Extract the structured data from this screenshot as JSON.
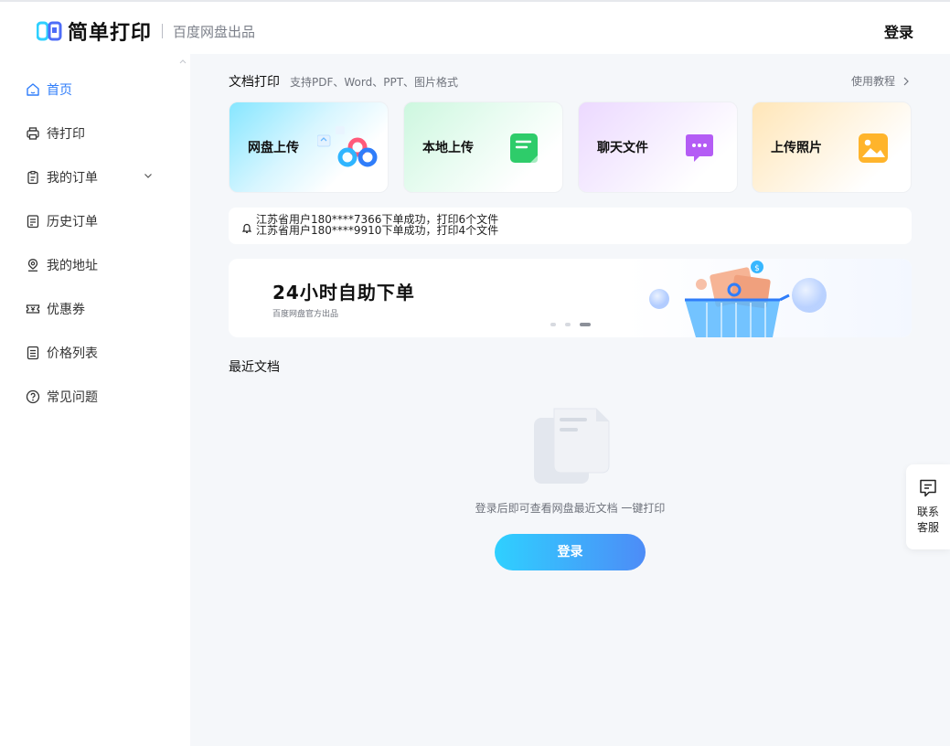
{
  "header": {
    "brand": "简单打印",
    "sub_brand": "百度网盘出品",
    "login_label": "登录"
  },
  "sidebar": {
    "items": [
      {
        "label": "首页",
        "icon": "home-icon",
        "active": true
      },
      {
        "label": "待打印",
        "icon": "printer-icon",
        "active": false
      },
      {
        "label": "我的订单",
        "icon": "clipboard-icon",
        "active": false,
        "expandable": true
      },
      {
        "label": "历史订单",
        "icon": "history-order-icon",
        "active": false
      },
      {
        "label": "我的地址",
        "icon": "location-icon",
        "active": false
      },
      {
        "label": "优惠券",
        "icon": "coupon-icon",
        "active": false
      },
      {
        "label": "价格列表",
        "icon": "price-list-icon",
        "active": false
      },
      {
        "label": "常见问题",
        "icon": "question-icon",
        "active": false
      }
    ]
  },
  "doc_print": {
    "title": "文档打印",
    "subtitle": "支持PDF、Word、PPT、图片格式",
    "tutorial_label": "使用教程",
    "cards": [
      {
        "label": "网盘上传",
        "icon": "netdisk-cloud-icon"
      },
      {
        "label": "本地上传",
        "icon": "local-file-icon"
      },
      {
        "label": "聊天文件",
        "icon": "chat-file-icon"
      },
      {
        "label": "上传照片",
        "icon": "photo-icon"
      }
    ]
  },
  "notice": {
    "line1": "江苏省用户180****7366下单成功，打印6个文件",
    "line2": "江苏省用户180****9910下单成功，打印4个文件"
  },
  "banner": {
    "title": "24小时自助下单",
    "subtitle": "百度网盘官方出品",
    "active_dot": 3,
    "dot_count": 3
  },
  "recent": {
    "title": "最近文档",
    "empty_text": "登录后即可查看网盘最近文档 一键打印",
    "login_button": "登录"
  },
  "service": {
    "line1": "联系",
    "line2": "客服"
  },
  "colors": {
    "accent": "#2f7dfa",
    "button_start": "#2fd0ff",
    "button_end": "#4d8cf7"
  }
}
